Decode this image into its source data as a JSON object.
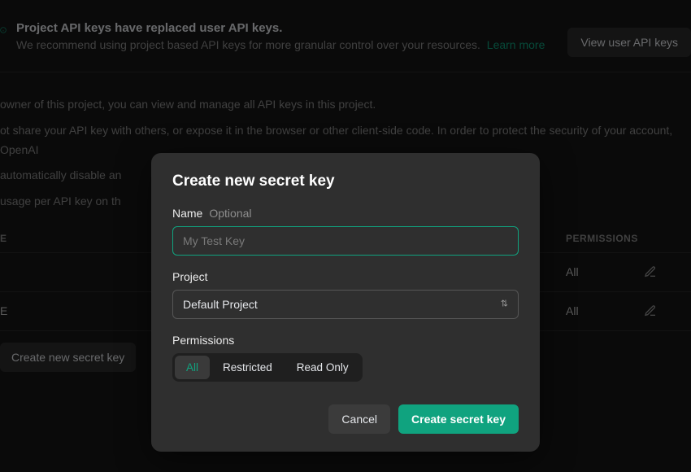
{
  "banner": {
    "title": "Project API keys have replaced user API keys.",
    "subtitle": "We recommend using project based API keys for more granular control over your resources.",
    "learn_more": "Learn more",
    "view_btn": "View user API keys"
  },
  "page": {
    "line1": "owner of this project, you can view and manage all API keys in this project.",
    "line2": "ot share your API key with others, or expose it in the browser or other client-side code. In order to protect the security of your account, OpenAI",
    "line3": "automatically disable an",
    "line4": "usage per API key on th",
    "create_btn": "Create new secret key"
  },
  "table": {
    "col_name": "E",
    "col_perm": "PERMISSIONS",
    "rows": [
      {
        "name": "",
        "perm": "All"
      },
      {
        "name": "E",
        "perm": "All"
      }
    ]
  },
  "modal": {
    "title": "Create new secret key",
    "name_label": "Name",
    "name_hint": "Optional",
    "name_placeholder": "My Test Key",
    "name_value": "",
    "project_label": "Project",
    "project_selected": "Default Project",
    "perm_label": "Permissions",
    "perm_options": {
      "all": "All",
      "restricted": "Restricted",
      "readonly": "Read Only"
    },
    "perm_active": "all",
    "cancel": "Cancel",
    "submit": "Create secret key"
  },
  "colors": {
    "accent": "#10a37f"
  }
}
